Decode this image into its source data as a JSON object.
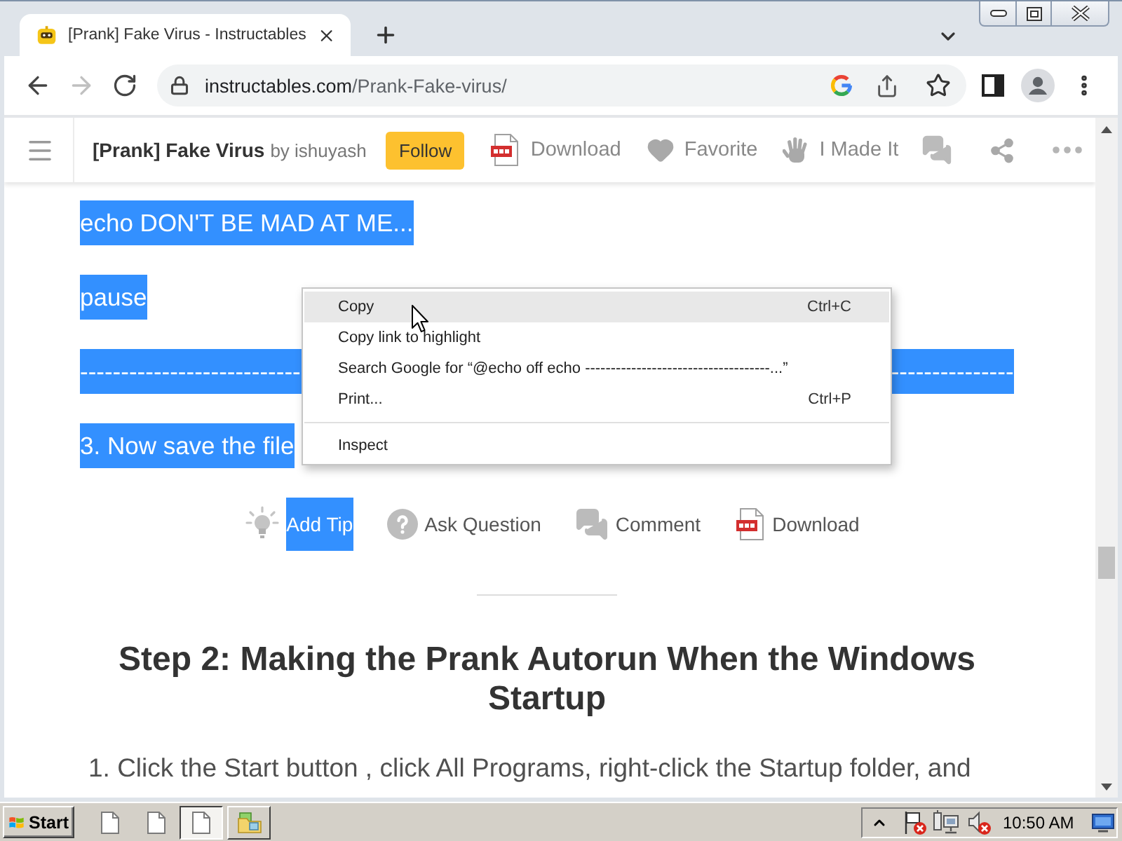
{
  "tabs": [
    {
      "title": "[Prank] Fake Virus - Instructables",
      "selected": true
    }
  ],
  "address_bar": {
    "host": "instructables.com",
    "path": "/Prank-Fake-virus/"
  },
  "article_bar": {
    "title": "[Prank] Fake Virus",
    "author": "by ishuyash",
    "follow": "Follow",
    "actions": [
      {
        "kind": "pdf",
        "label": "Download"
      },
      {
        "kind": "heart",
        "label": "Favorite"
      },
      {
        "kind": "hand",
        "label": "I Made It"
      },
      {
        "kind": "comment"
      },
      {
        "kind": "share"
      },
      {
        "kind": "more"
      }
    ]
  },
  "selected_lines": [
    {
      "text": "echo DON'T BE MAD AT ME...",
      "highlighted": true
    },
    {
      "text": "pause",
      "highlighted": true
    },
    {
      "segments": [
        "---------------------------",
        "---------------"
      ],
      "highlighted": true
    },
    {
      "text": "3. Now save the file",
      "highlighted": true
    }
  ],
  "context_menu": {
    "items": [
      {
        "kind": "item",
        "label": "Copy",
        "shortcut": "Ctrl+C",
        "highlighted": true
      },
      {
        "kind": "item",
        "label": "Copy link to highlight",
        "highlighted": false
      },
      {
        "kind": "item",
        "label": "Search Google for “@echo off echo ------------------------------------...”",
        "highlighted": false
      },
      {
        "kind": "item",
        "label": "Print...",
        "shortcut": "Ctrl+P",
        "highlighted": false
      },
      {
        "kind": "separator"
      },
      {
        "kind": "item",
        "label": "Inspect",
        "highlighted": false
      }
    ]
  },
  "step_actions": [
    {
      "kind": "tip",
      "label": "Add Tip",
      "highlighted": true
    },
    {
      "kind": "question",
      "label": "Ask Question",
      "highlighted": false
    },
    {
      "kind": "comment",
      "label": "Comment",
      "highlighted": false
    },
    {
      "kind": "pdf",
      "label": "Download",
      "highlighted": false
    }
  ],
  "step": {
    "heading": "Step 2: Making the Prank Autorun When the Windows Startup",
    "text": "1. Click the Start button , click All Programs, right-click the Startup folder, and"
  },
  "taskbar": {
    "start": "Start",
    "windows": [
      {
        "kind": "document",
        "selected": true
      },
      {
        "kind": "folder",
        "selected": false
      }
    ],
    "clock": "10:50 AM"
  }
}
